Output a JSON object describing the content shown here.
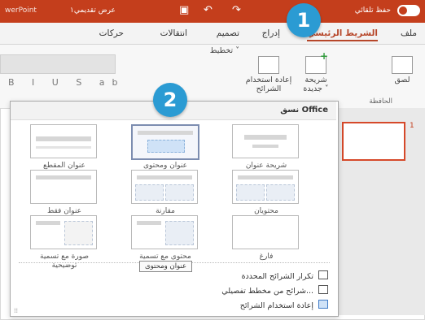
{
  "titlebar": {
    "app": "werPoint",
    "document": "عرض تقديمي١",
    "autosave": "حفظ تلقائي"
  },
  "tabs": [
    "ملف",
    "الشريط الرئيسي",
    "إدراج",
    "تصميم",
    "انتقالات",
    "حركات"
  ],
  "active_tab_index": 1,
  "ribbon": {
    "paste": "لصق",
    "new_slide": "شريحة جديدة ˅",
    "reuse": "إعادة استخدام الشرائح",
    "layout": "تخطيط ˅",
    "clipboard_group": "الحافظة",
    "format_buttons": "B I U S ab"
  },
  "callouts": [
    "1",
    "2"
  ],
  "layout_menu": {
    "title": "نسق Office",
    "tooltip": "عنوان ومحتوى",
    "layouts": [
      {
        "label": "شريحة عنوان",
        "type": "title"
      },
      {
        "label": "عنوان ومحتوى",
        "type": "content",
        "selected": true
      },
      {
        "label": "عنوان المقطع",
        "type": "section"
      },
      {
        "label": "محتويان",
        "type": "two"
      },
      {
        "label": "مقارنة",
        "type": "comparison"
      },
      {
        "label": "عنوان فقط",
        "type": "titleonly"
      },
      {
        "label": "فارغ",
        "type": "blank"
      },
      {
        "label": "محتوى مع تسمية توضيحية",
        "type": "caption"
      },
      {
        "label": "صورة مع تسمية توضيحية",
        "type": "picture"
      }
    ],
    "commands": [
      {
        "label": "تكرار الشرائح المحددة",
        "icon": "duplicate-slides-icon"
      },
      {
        "label": "شرائح من مخطط تفصيلي...",
        "icon": "outline-slides-icon"
      },
      {
        "label": "إعادة استخدام الشرائح",
        "icon": "reuse-slides-icon"
      }
    ]
  },
  "slide_pane": {
    "number": "1"
  },
  "colors": {
    "accent": "#c43e1c",
    "callout": "#2b9bd3"
  }
}
